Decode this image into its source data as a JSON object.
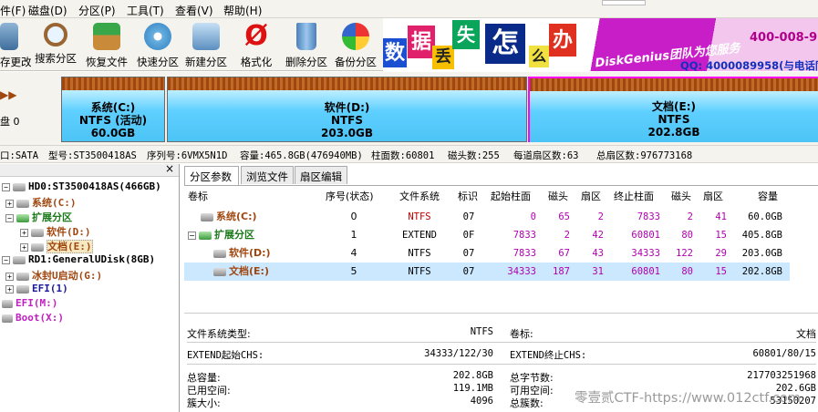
{
  "menu": {
    "file": "件(F)",
    "disk": "磁盘(D)",
    "partition": "分区(P)",
    "tools": "工具(T)",
    "view": "查看(V)",
    "help": "帮助(H)"
  },
  "toolbar": {
    "save": "存更改",
    "search": "搜索分区",
    "recover": "恢复文件",
    "quick": "快速分区",
    "new": "新建分区",
    "format": "格式化",
    "delete": "删除分区",
    "backup": "备份分区"
  },
  "banner": {
    "chars": [
      "数",
      "据",
      "丢",
      "失",
      "怎",
      "么",
      "办"
    ],
    "slogan": "DiskGenius团队为您服务",
    "phone": "400-008-9",
    "qq": "QQ: 4000089958(与电话同"
  },
  "diskmap": {
    "left_label": "盘 0",
    "parts": [
      {
        "name": "系统(C:)",
        "fs": "NTFS (活动)",
        "size": "60.0GB"
      },
      {
        "name": "软件(D:)",
        "fs": "NTFS",
        "size": "203.0GB"
      },
      {
        "name": "文档(E:)",
        "fs": "NTFS",
        "size": "202.8GB"
      }
    ]
  },
  "info": {
    "iface": "口:SATA",
    "model": "型号:ST3500418AS",
    "serial": "序列号:6VMX5N1D",
    "capacity": "容量:465.8GB(476940MB)",
    "cyl": "柱面数:60801",
    "heads": "磁头数:255",
    "spt": "每道扇区数:63",
    "total": "总扇区数:976773168"
  },
  "tree": {
    "hd0": "HD0:ST3500418AS(466GB)",
    "c": "系统(C:)",
    "ext": "扩展分区",
    "d": "软件(D:)",
    "e": "文档(E:)",
    "rd1": "RD1:GeneralUDisk(8GB)",
    "ice": "冰封U启动(G:)",
    "efi": "EFI(1)",
    "efim": "EFI(M:)",
    "boot": "Boot(X:)"
  },
  "tabs": {
    "params": "分区参数",
    "browse": "浏览文件",
    "edit": "扇区编辑"
  },
  "grid": {
    "headers": [
      "卷标",
      "序号(状态)",
      "文件系统",
      "标识",
      "起始柱面",
      "磁头",
      "扇区",
      "终止柱面",
      "磁头",
      "扇区",
      "容量"
    ],
    "rows": [
      {
        "label": "系统(C:)",
        "idx": "0",
        "fs": "NTFS",
        "id": "07",
        "sc": "0",
        "sh": "65",
        "ss": "2",
        "ec": "7833",
        "eh": "2",
        "es": "41",
        "cap": "60.0GB"
      },
      {
        "label": "扩展分区",
        "idx": "1",
        "fs": "EXTEND",
        "id": "0F",
        "sc": "7833",
        "sh": "2",
        "ss": "42",
        "ec": "60801",
        "eh": "80",
        "es": "15",
        "cap": "405.8GB"
      },
      {
        "label": "软件(D:)",
        "idx": "4",
        "fs": "NTFS",
        "id": "07",
        "sc": "7833",
        "sh": "67",
        "ss": "43",
        "ec": "34333",
        "eh": "122",
        "es": "29",
        "cap": "203.0GB"
      },
      {
        "label": "文档(E:)",
        "idx": "5",
        "fs": "NTFS",
        "id": "07",
        "sc": "34333",
        "sh": "187",
        "ss": "31",
        "ec": "60801",
        "eh": "80",
        "es": "15",
        "cap": "202.8GB"
      }
    ]
  },
  "details": {
    "fs_type_label": "文件系统类型:",
    "fs_type": "NTFS",
    "vol_label": "卷标:",
    "vol": "文档",
    "ext_start_label": "EXTEND起始CHS:",
    "ext_start": "34333/122/30",
    "ext_end_label": "EXTEND终止CHS:",
    "ext_end": "60801/80/15",
    "total_label": "总容量:",
    "total": "202.8GB",
    "bytes_label": "总字节数:",
    "bytes": "217703251968",
    "used_label": "已用空间:",
    "used": "119.1MB",
    "free_label": "可用空间:",
    "free": "202.6GB",
    "cluster_label": "簇大小:",
    "cluster": "4096",
    "clusters_label": "总簇数:",
    "clusters": "53150207"
  },
  "watermark": "零壹贰CTF-https://www.012ctf.com",
  "colors": {
    "accent_brown": "#a0460f",
    "partition_blue": "#4cc4f6",
    "selected_row": "#cce8ff",
    "cyl_magenta": "#b000b0"
  }
}
